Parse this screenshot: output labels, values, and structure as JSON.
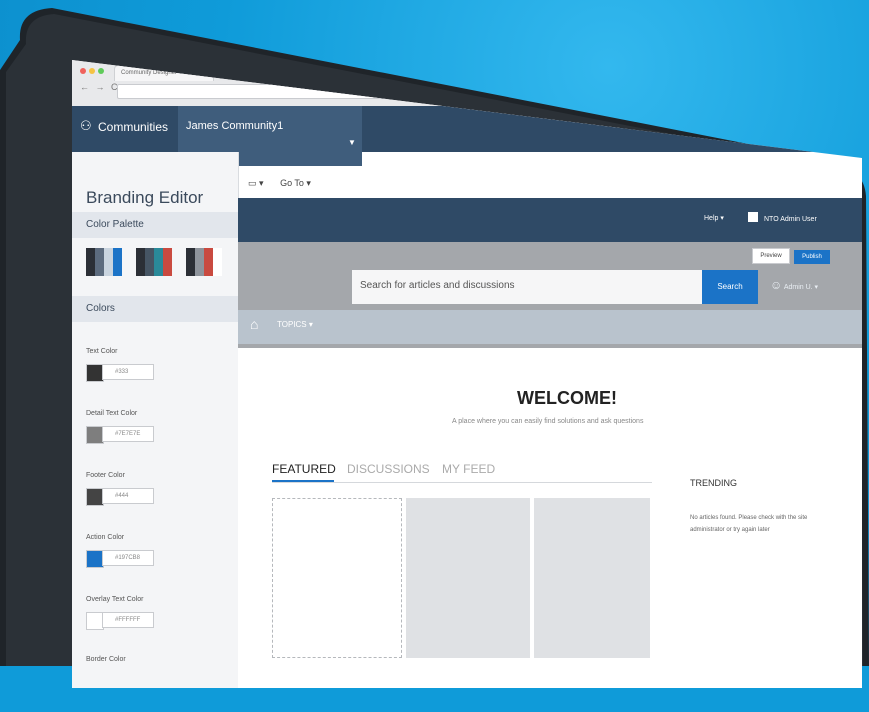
{
  "browser": {
    "tab_title": "Community Designer",
    "nav_buttons": "← → C"
  },
  "header": {
    "app_name": "Communities",
    "community_name": "James Community1",
    "help_label": "Help ▾",
    "user_name": "NTO Admin User",
    "preview_label": "Preview",
    "publish_label": "Publish"
  },
  "toolbar": {
    "device_label": "▾",
    "goto_label": "Go To ▾"
  },
  "sidebar": {
    "title": "Branding Editor",
    "palette_heading": "Color Palette",
    "colors_heading": "Colors",
    "palettes": [
      [
        "#2b2f36",
        "#5c6b7e",
        "#c9d4df",
        "#1b73c7"
      ],
      [
        "#2b2f36",
        "#465564",
        "#c94a40",
        "#2a8a9a"
      ],
      [
        "#2b2f36",
        "#8e949c",
        "#c94a40",
        "#ffffff"
      ]
    ],
    "colors": [
      {
        "label": "Text Color",
        "swatch": "#333333",
        "hex": "#333"
      },
      {
        "label": "Detail Text Color",
        "swatch": "#7e7e7e",
        "hex": "#7E7E7E"
      },
      {
        "label": "Footer Color",
        "swatch": "#444444",
        "hex": "#444"
      },
      {
        "label": "Action Color",
        "swatch": "#1b73c7",
        "hex": "#197CB8"
      },
      {
        "label": "Overlay Text Color",
        "swatch": "#ffffff",
        "hex": "#FFFFFF"
      },
      {
        "label": "Border Color",
        "swatch": "#dddddd",
        "hex": ""
      }
    ]
  },
  "hero": {
    "search_placeholder": "Search for articles and discussions",
    "search_button": "Search",
    "user_pill": "Admin U. ▾"
  },
  "topics_nav": {
    "topics_label": "TOPICS ▾"
  },
  "main": {
    "welcome_title": "WELCOME!",
    "welcome_sub": "A place where you can easily find solutions and ask questions",
    "tabs": [
      "FEATURED",
      "DISCUSSIONS",
      "MY FEED"
    ],
    "trending_title": "TRENDING",
    "trending_empty": "No articles found. Please check with the site administrator or try again later"
  },
  "colors": {
    "background": "#0f9bd9",
    "nav_dark": "#2f4a66",
    "accent": "#1b73c7"
  }
}
